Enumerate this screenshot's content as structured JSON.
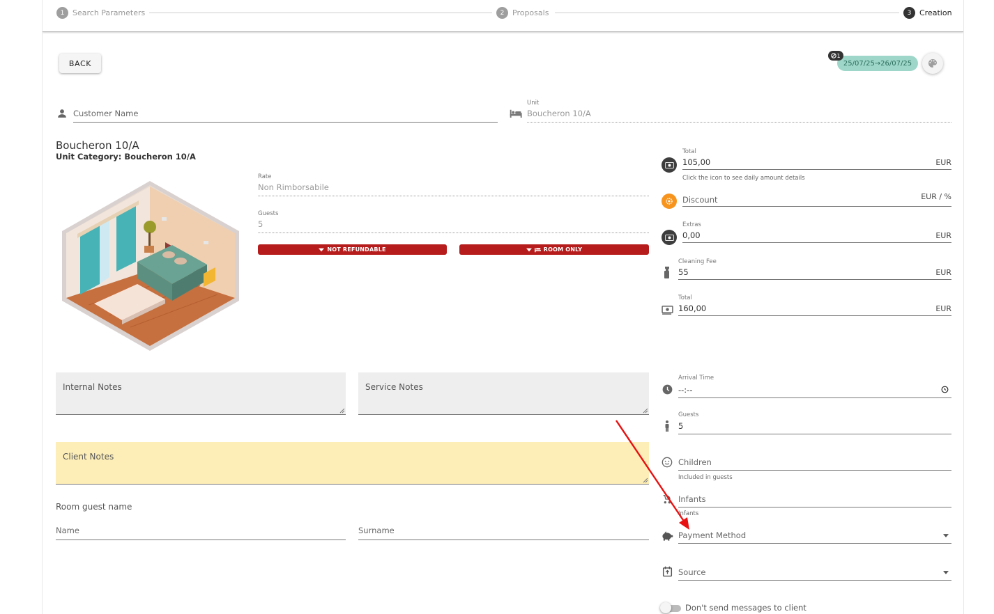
{
  "stepper": {
    "steps": [
      {
        "num": "1",
        "label": "Search Parameters"
      },
      {
        "num": "2",
        "label": "Proposals"
      },
      {
        "num": "3",
        "label": "Creation"
      }
    ]
  },
  "toolbar": {
    "back_label": "BACK",
    "date_range": "25/07/25→26/07/25",
    "badge_count": "1"
  },
  "customer": {
    "placeholder": "Customer Name"
  },
  "unit": {
    "label": "Unit",
    "value": "Boucheron 10/A"
  },
  "property": {
    "title": "Boucheron 10/A",
    "category": "Unit Category: Boucheron 10/A"
  },
  "rate": {
    "label": "Rate",
    "value": "Non Rimborsabile"
  },
  "guests_ro": {
    "label": "Guests",
    "value": "5"
  },
  "tags": {
    "not_refundable": "NOT REFUNDABLE",
    "room_only": "ROOM ONLY"
  },
  "pricing": {
    "total": {
      "label": "Total",
      "value": "105,00",
      "unit": "EUR",
      "hint": "Click the icon to see daily amount details"
    },
    "discount": {
      "placeholder": "Discount",
      "unit": "EUR / %"
    },
    "extras": {
      "label": "Extras",
      "value": "0,00",
      "unit": "EUR"
    },
    "cleaning": {
      "label": "Cleaning Fee",
      "value": "55",
      "unit": "EUR"
    },
    "grand_total": {
      "label": "Total",
      "value": "160,00",
      "unit": "EUR"
    }
  },
  "notes": {
    "internal": "Internal Notes",
    "service": "Service Notes",
    "client": "Client Notes"
  },
  "guest_name": {
    "heading": "Room guest name",
    "name": "Name",
    "surname": "Surname"
  },
  "details": {
    "arrival": {
      "label": "Arrival Time",
      "value": "--:--"
    },
    "guests": {
      "label": "Guests",
      "value": "5"
    },
    "children": {
      "placeholder": "Children",
      "hint": "Included in guests"
    },
    "infants": {
      "placeholder": "Infants",
      "hint": "Infants"
    },
    "payment": {
      "placeholder": "Payment Method"
    },
    "source": {
      "placeholder": "Source"
    },
    "no_messages": "Don't send messages to client"
  },
  "colors": {
    "accent_red": "#b71c1c",
    "chip_teal": "#9ed7c9",
    "discount_orange": "#f7941d",
    "annotation_arrow": "#e81010"
  }
}
